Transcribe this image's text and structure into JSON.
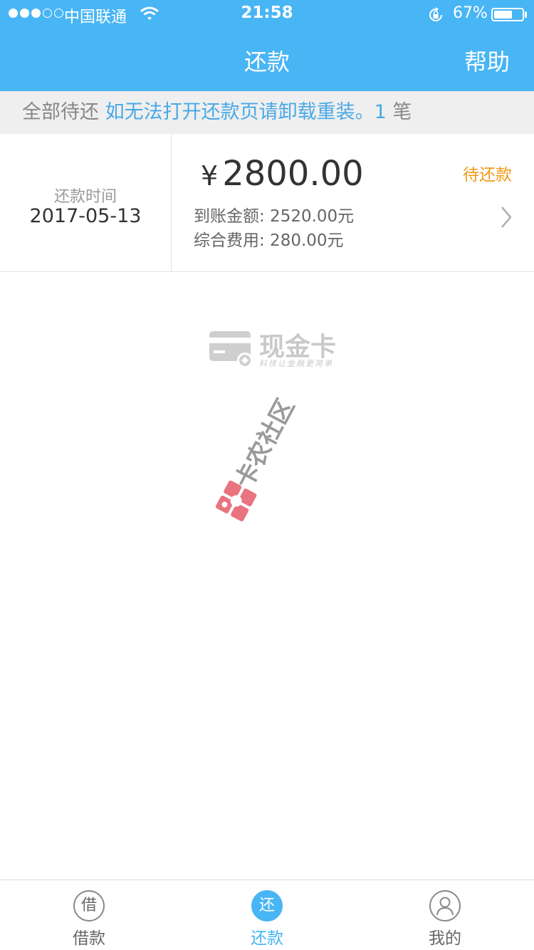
{
  "status_bar": {
    "carrier": "中国联通",
    "time": "21:58",
    "battery_percent": "67%",
    "battery_level": 0.67,
    "signal_bars": 3,
    "signal_total": 5
  },
  "nav": {
    "title": "还款",
    "help": "帮助"
  },
  "notice": {
    "prefix": "全部待还",
    "message": "如无法打开还款页请卸载重装。",
    "count": "1",
    "unit": "笔"
  },
  "record": {
    "due_label": "还款时间",
    "due_date": "2017-05-13",
    "currency_symbol": "¥",
    "amount": "2800.00",
    "received_label": "到账金额: 2520.00元",
    "fee_label": "综合费用: 280.00元",
    "status": "待还款"
  },
  "watermark": {
    "brand": "现金卡",
    "tagline": "科技让金融更简单",
    "community": "卡农社区"
  },
  "tabs": [
    {
      "icon": "借",
      "label": "借款",
      "active": false
    },
    {
      "icon": "还",
      "label": "还款",
      "active": true
    },
    {
      "icon": "",
      "label": "我的",
      "active": false
    }
  ],
  "colors": {
    "primary": "#48b5f4",
    "status_pending": "#f09a16",
    "notice_link": "#48a9e6"
  }
}
